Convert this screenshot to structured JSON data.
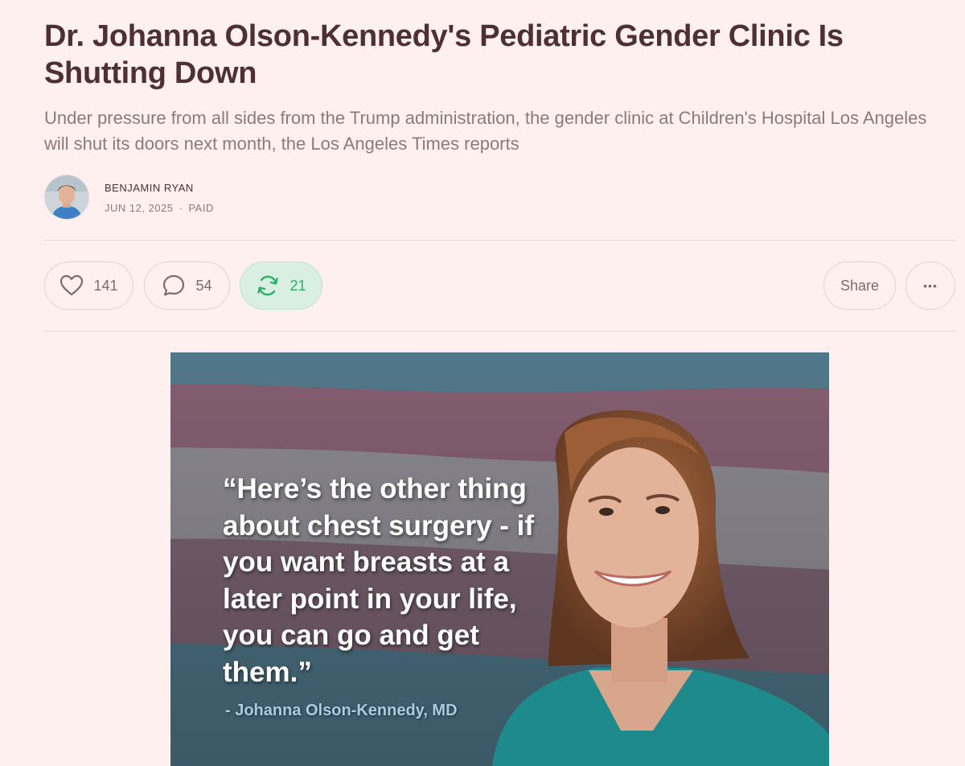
{
  "article": {
    "title": "Dr. Johanna Olson-Kennedy's Pediatric Gender Clinic Is Shutting Down",
    "subtitle": "Under pressure from all sides from the Trump administration, the gender clinic at Children's Hospital Los Angeles will shut its doors next month, the Los Angeles Times reports"
  },
  "byline": {
    "author": "BENJAMIN RYAN",
    "date": "JUN 12, 2025",
    "separator": "·",
    "access": "PAID"
  },
  "actions": {
    "like_count": "141",
    "comment_count": "54",
    "restack_count": "21",
    "share_label": "Share",
    "more_label": "•••"
  },
  "image": {
    "quote": "“Here’s the other thing about chest surgery - if you want breasts at a later point in your life, you can go and get them.”",
    "attribution": "- Johanna Olson-Kennedy, MD"
  },
  "colors": {
    "background": "#fdf0ef",
    "title": "#4e2f34",
    "muted": "#8a7a7c",
    "restack_accent": "#2fae65",
    "restack_bg": "#d9efe1"
  }
}
